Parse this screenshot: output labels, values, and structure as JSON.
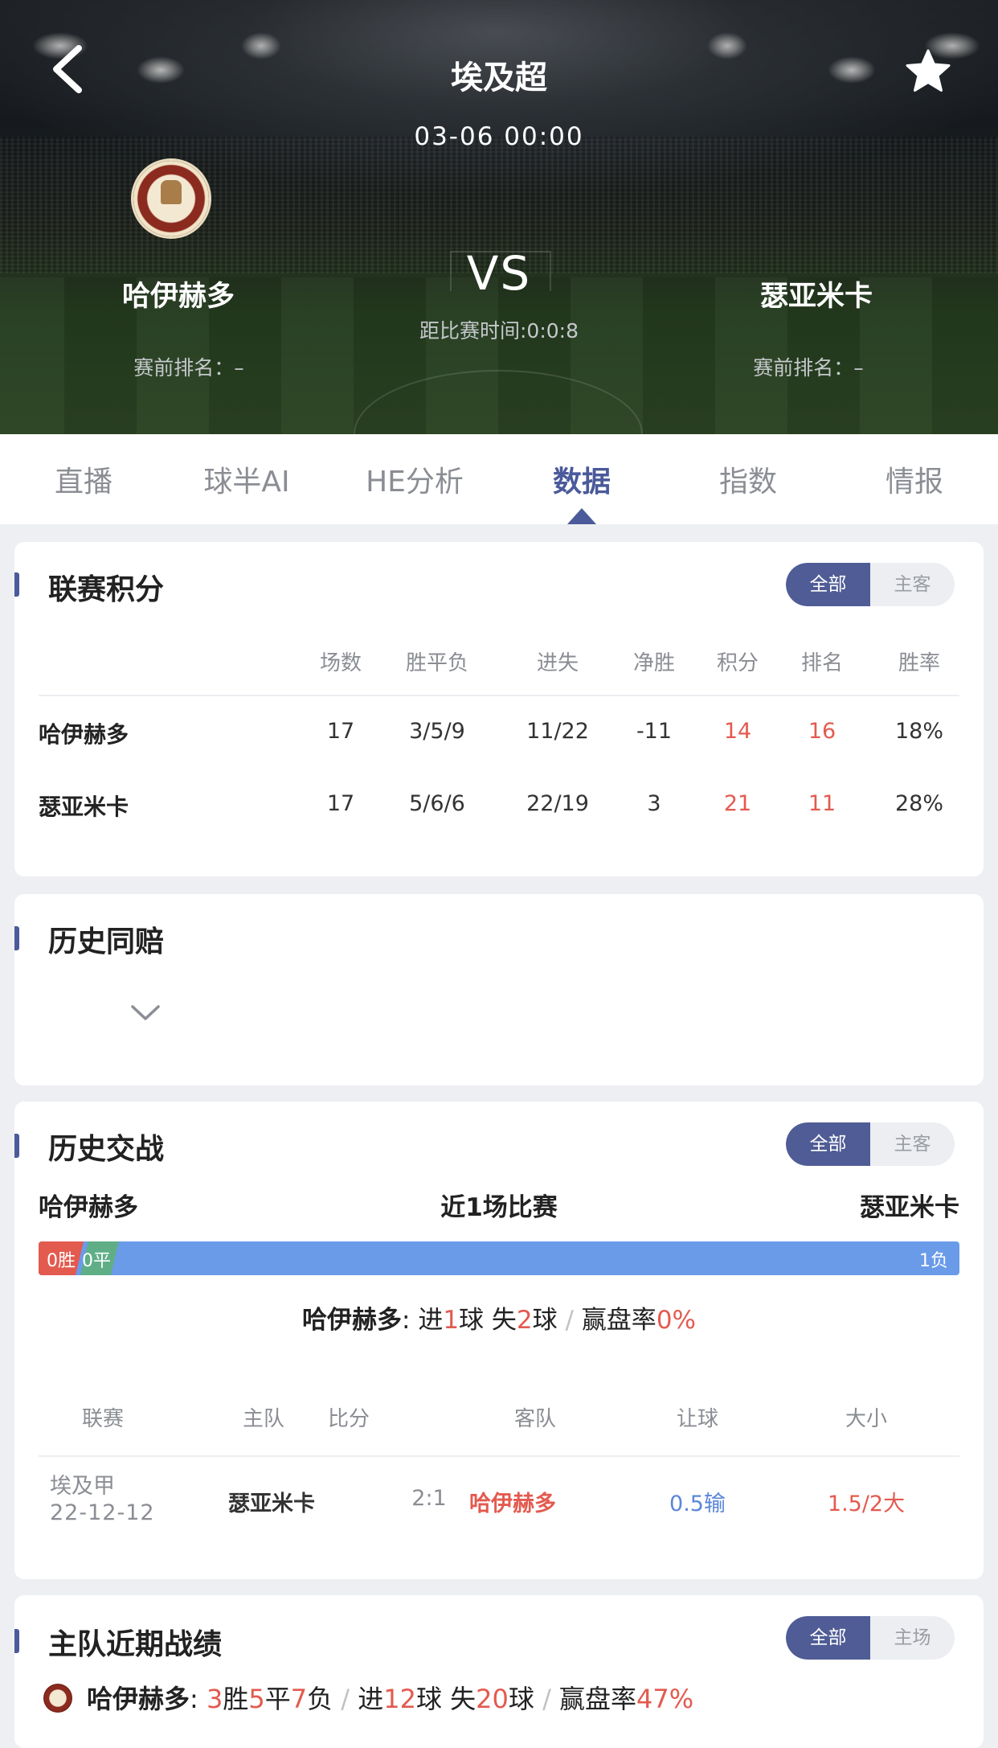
{
  "header": {
    "title": "埃及超",
    "match_time": "03-06 00:00",
    "vs": "VS",
    "countdown": "距比赛时间:0:0:8",
    "home_team": "哈伊赫多",
    "away_team": "瑟亚米卡",
    "home_rank": "赛前排名：–",
    "away_rank": "赛前排名：–"
  },
  "tabs": [
    "直播",
    "球半AI",
    "HE分析",
    "数据",
    "指数",
    "情报"
  ],
  "active_tab": "数据",
  "colors": {
    "accent": "#4a5a9a",
    "red": "#e35a4f",
    "blue": "#5b86d8",
    "green": "#5fae86"
  },
  "league_table": {
    "title": "联赛积分",
    "toggle": [
      "全部",
      "主客"
    ],
    "headers": [
      "场数",
      "胜平负",
      "进失",
      "净胜",
      "积分",
      "排名",
      "胜率"
    ],
    "rows": [
      {
        "team": "哈伊赫多",
        "played": "17",
        "wdl": "3/5/9",
        "goals": "11/22",
        "diff": "-11",
        "points": "14",
        "rank": "16",
        "rate": "18%"
      },
      {
        "team": "瑟亚米卡",
        "played": "17",
        "wdl": "5/6/6",
        "goals": "22/19",
        "diff": "3",
        "points": "21",
        "rank": "11",
        "rate": "28%"
      }
    ]
  },
  "same_odds": {
    "title": "历史同赔"
  },
  "h2h": {
    "title": "历史交战",
    "toggle": [
      "全部",
      "主客"
    ],
    "home": "哈伊赫多",
    "away": "瑟亚米卡",
    "recent": "近1场比赛",
    "bar": {
      "win": "0胜",
      "draw": "0平",
      "loss": "1负",
      "win_count": 0,
      "draw_count": 0,
      "loss_count": 1
    },
    "summary": {
      "team": "哈伊赫多",
      "colon": ":",
      "in_label": "进",
      "in": "1",
      "ball1": "球",
      "lost_label": "失",
      "lost": "2",
      "ball2": "球",
      "sep": "/",
      "rate_label": "赢盘率",
      "rate": "0%"
    },
    "headers": [
      "联赛",
      "主队",
      "比分",
      "客队",
      "让球",
      "大小"
    ],
    "rows": [
      {
        "league": "埃及甲",
        "date": "22-12-12",
        "home": "瑟亚米卡",
        "score": "2:1",
        "away": "哈伊赫多",
        "handicap_val": "0.5",
        "handicap_res": "输",
        "ou_val": "1.5/2",
        "ou_res": "大"
      }
    ]
  },
  "recent_form": {
    "title": "主队近期战绩",
    "toggle": [
      "全部",
      "主场"
    ],
    "team": "哈伊赫多",
    "colon": ":",
    "w": "3",
    "w_label": "胜",
    "d": "5",
    "d_label": "平",
    "l": "7",
    "l_label": "负",
    "sep": "/",
    "in_label": "进",
    "in": "12",
    "ball1": "球",
    "lost_label": "失",
    "lost": "20",
    "ball2": "球",
    "rate_label": "赢盘率",
    "rate": "47%"
  }
}
